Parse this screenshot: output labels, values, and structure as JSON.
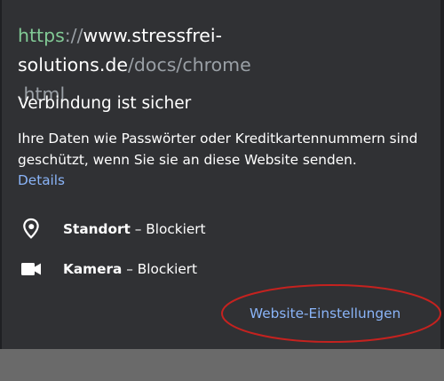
{
  "site_info": {
    "url": {
      "scheme": "https",
      "separator": "://",
      "host": "www.stressfrei-solutions.de",
      "path_line1": "/docs/chrome",
      "path_line2": ".html"
    },
    "security": {
      "heading": "Verbindung ist sicher",
      "description": "Ihre Daten wie Passwörter oder Kreditkartennummern sind geschützt, wenn Sie sie an diese Website senden.",
      "details_link": "Details"
    },
    "permissions": [
      {
        "name": "Standort",
        "dash": " – ",
        "status": "Blockiert",
        "icon": "location-pin-icon"
      },
      {
        "name": "Kamera",
        "dash": " – ",
        "status": "Blockiert",
        "icon": "camera-icon"
      }
    ],
    "settings_link": "Website-Einstellungen"
  },
  "colors": {
    "panel_bg": "#303134",
    "scheme_green": "#81c995",
    "path_gray": "#9aa0a6",
    "link_blue": "#8ab4f8",
    "highlight_red": "#c5221f",
    "backdrop": "#6a6a6a"
  }
}
